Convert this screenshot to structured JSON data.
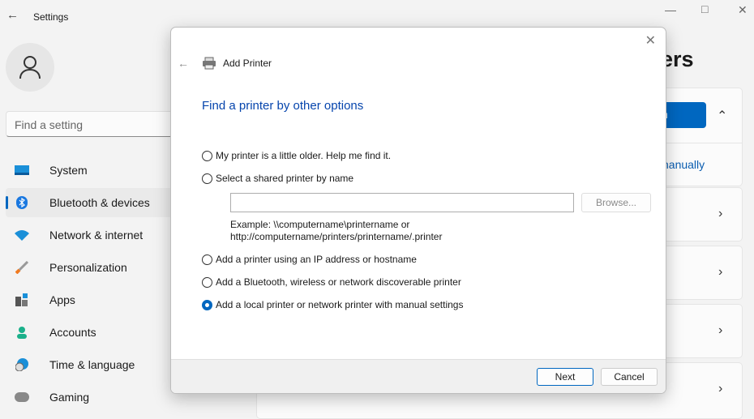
{
  "window": {
    "title": "Settings"
  },
  "sidebar": {
    "search_placeholder": "Find a setting",
    "items": [
      {
        "label": "System",
        "icon": "monitor-icon"
      },
      {
        "label": "Bluetooth & devices",
        "icon": "bluetooth-icon",
        "selected": true
      },
      {
        "label": "Network & internet",
        "icon": "wifi-icon"
      },
      {
        "label": "Personalization",
        "icon": "brush-icon"
      },
      {
        "label": "Apps",
        "icon": "apps-icon"
      },
      {
        "label": "Accounts",
        "icon": "person-icon"
      },
      {
        "label": "Time & language",
        "icon": "clock-globe-icon"
      },
      {
        "label": "Gaming",
        "icon": "gamepad-icon"
      }
    ]
  },
  "main": {
    "heading_fragment": "ers",
    "button_fragment": "n",
    "link_fragment": "nanually"
  },
  "dialog": {
    "title": "Add Printer",
    "heading": "Find a printer by other options",
    "options": [
      {
        "label": "My printer is a little older. Help me find it.",
        "selected": false
      },
      {
        "label": "Select a shared printer by name",
        "selected": false
      },
      {
        "label": "Add a printer using an IP address or hostname",
        "selected": false
      },
      {
        "label": "Add a Bluetooth, wireless or network discoverable printer",
        "selected": false
      },
      {
        "label": "Add a local printer or network printer with manual settings",
        "selected": true
      }
    ],
    "shared_name_value": "",
    "browse_label": "Browse...",
    "example_line1": "Example: \\\\computername\\printername or",
    "example_line2": "http://computername/printers/printername/.printer",
    "next_label": "Next",
    "cancel_label": "Cancel"
  },
  "colors": {
    "accent": "#0067c0",
    "dialog_heading": "#0645ad"
  }
}
